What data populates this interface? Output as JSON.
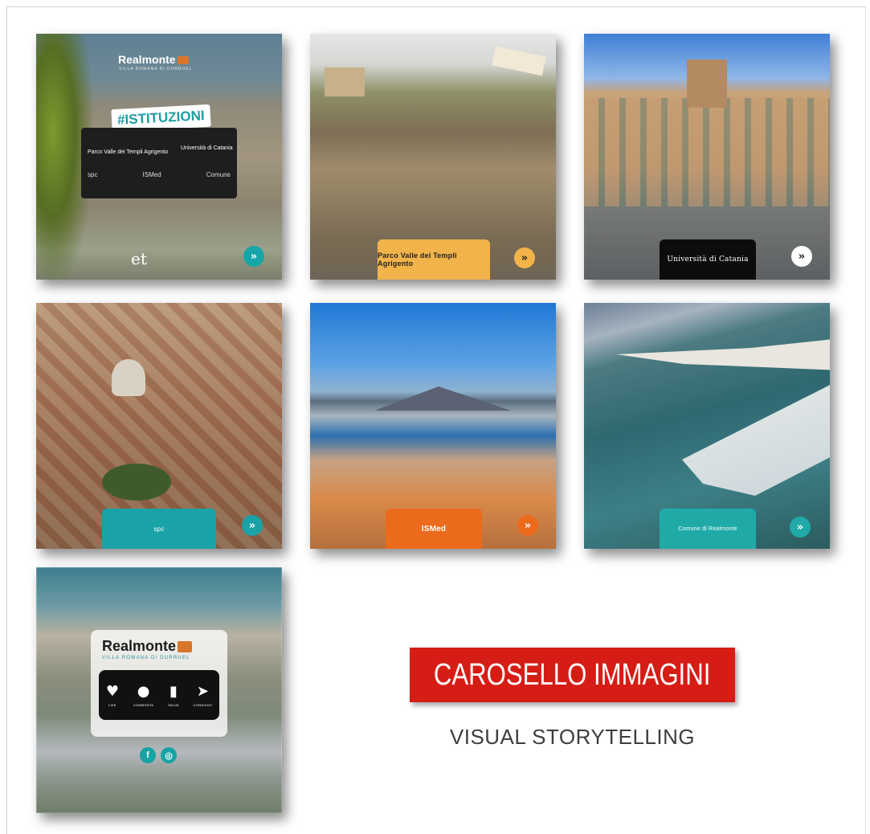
{
  "slides": [
    {
      "brand": "Realmonte",
      "brand_subtitle": "VILLA ROMANA DI DURRUEL",
      "hashtag": "#ISTITUZIONI",
      "panel_left": "Parco Valle dei Templi Agrigento",
      "panel_right": "Università di Catania",
      "panel_logos": [
        "spc",
        "ISMed",
        "Comune"
      ],
      "footer_mark": "et",
      "next": "»",
      "accent": "#17a5a9"
    },
    {
      "badge": "Parco Valle dei Templi Agrigento",
      "next": "»",
      "accent": "#f2b44a"
    },
    {
      "badge": "Università di Catania",
      "next": "»",
      "accent": "#0c0c0c"
    },
    {
      "badge": "spc",
      "next": "»",
      "accent": "#1aa3a6"
    },
    {
      "badge": "ISMed",
      "next": "»",
      "accent": "#ec6a1c"
    },
    {
      "badge": "Comune di Realmonte",
      "next": "»",
      "accent": "#1faaa8"
    },
    {
      "brand": "Realmonte",
      "brand_subtitle": "VILLA ROMANA DI DURRUEL",
      "actions": [
        {
          "icon": "heart-icon",
          "glyph": "♥",
          "label": "LIKE"
        },
        {
          "icon": "comment-icon",
          "glyph": "●",
          "label": "COMMENTA"
        },
        {
          "icon": "bookmark-icon",
          "glyph": "▮",
          "label": "SALVA"
        },
        {
          "icon": "send-icon",
          "glyph": "➤",
          "label": "CONDIVIDI"
        }
      ],
      "socials": [
        {
          "icon": "facebook-icon",
          "glyph": "f"
        },
        {
          "icon": "instagram-icon",
          "glyph": "◎"
        }
      ]
    }
  ],
  "title": "CAROSELLO IMMAGINI",
  "subtitle": "VISUAL STORYTELLING",
  "colors": {
    "title_bg": "#d51d15",
    "title_text": "#ffffff",
    "subtitle_text": "#3d3d3d"
  }
}
